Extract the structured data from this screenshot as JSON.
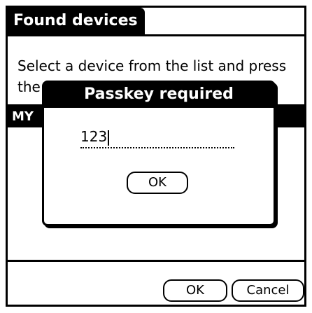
{
  "form": {
    "title": "Found devices",
    "instructions": "Select a device from the list and press the ok button",
    "devices": [
      {
        "label": "MY"
      }
    ],
    "ok_label": "OK",
    "cancel_label": "Cancel"
  },
  "dialog": {
    "title": "Passkey required",
    "passkey_value": "123",
    "ok_label": "OK"
  }
}
